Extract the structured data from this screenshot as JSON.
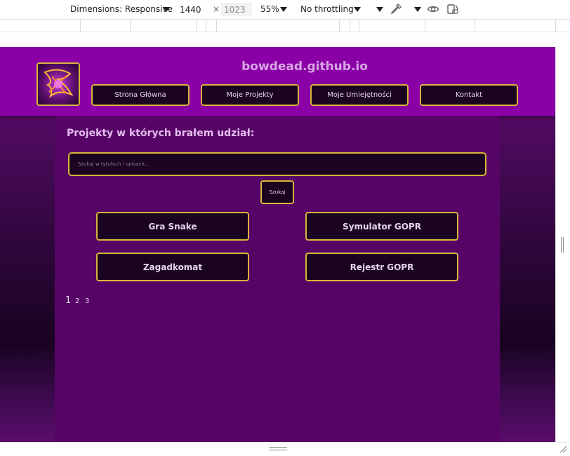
{
  "devtools": {
    "dimensions_label": "Dimensions: Responsive",
    "width": "1440",
    "height": "1023",
    "zoom": "55%",
    "throttling": "No throttling",
    "icons": [
      "dropdown-caret-icon",
      "eyedropper-icon",
      "eye-icon",
      "rotate-device-icon"
    ]
  },
  "site": {
    "title": "bowdead.github.io",
    "nav": [
      "Strona Główna",
      "Moje Projekty",
      "Moje Umiejętności",
      "Kontakt"
    ]
  },
  "main": {
    "heading": "Projekty w których brałem udział:",
    "search_placeholder": "Szukaj w tytułach i opisach...",
    "search_button": "Szukaj",
    "projects": [
      "Gra Snake",
      "Symulator GOPR",
      "Zagadkomat",
      "Rejestr GOPR"
    ],
    "pages": [
      "1",
      "2",
      "3"
    ]
  },
  "colors": {
    "header": "#8a00a6",
    "main": "#560566",
    "card": "#1a0420",
    "accent_border": "#d8b53a",
    "title_text": "#d7a6e4"
  }
}
